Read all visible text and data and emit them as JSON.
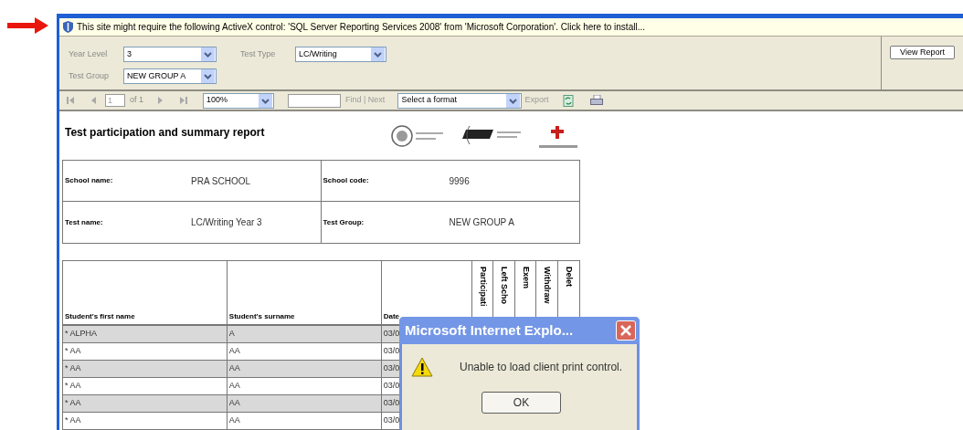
{
  "info_bar": {
    "text": "This site might require the following ActiveX control: 'SQL Server Reporting Services 2008' from 'Microsoft Corporation'. Click here to install..."
  },
  "parameters": [
    {
      "label": "Year Level",
      "value": "3"
    },
    {
      "label": "Test Type",
      "value": "LC/Writing"
    },
    {
      "label": "Test Group",
      "value": "NEW GROUP A"
    }
  ],
  "view_report_button": "View Report",
  "toolbar": {
    "page": "1",
    "page_count": "of 1",
    "zoom": "100%",
    "find_links": "Find | Next",
    "format": "Select a format",
    "export": "Export"
  },
  "report": {
    "title": "Test participation and summary report",
    "details": [
      {
        "label": "School name:",
        "value": "PRA SCHOOL"
      },
      {
        "label": "School code:",
        "value": "9996"
      },
      {
        "label": "Test name:",
        "value": "LC/Writing Year 3"
      },
      {
        "label": "Test Group:",
        "value": "NEW GROUP A"
      }
    ],
    "columns": [
      {
        "label": "Student's first name",
        "kind": "text"
      },
      {
        "label": "Student's surname",
        "kind": "text"
      },
      {
        "label": "Date",
        "kind": "text"
      },
      {
        "label": "Participati",
        "kind": "vertical"
      },
      {
        "label": "Left Scho",
        "kind": "vertical"
      },
      {
        "label": "Exem",
        "kind": "vertical"
      },
      {
        "label": "Withdraw",
        "kind": "vertical"
      },
      {
        "label": "Delet",
        "kind": "vertical"
      }
    ],
    "rows": [
      [
        "* ALPHA",
        "A",
        "03/0"
      ],
      [
        "* AA",
        "AA",
        "03/0"
      ],
      [
        "* AA",
        "AA",
        "03/0"
      ],
      [
        "* AA",
        "AA",
        "03/0"
      ],
      [
        "* AA",
        "AA",
        "03/0"
      ],
      [
        "* AA",
        "AA",
        "03/0"
      ]
    ]
  },
  "dialog": {
    "title": "Microsoft Internet Explo...",
    "message": "Unable to load client print control.",
    "button": "OK"
  }
}
